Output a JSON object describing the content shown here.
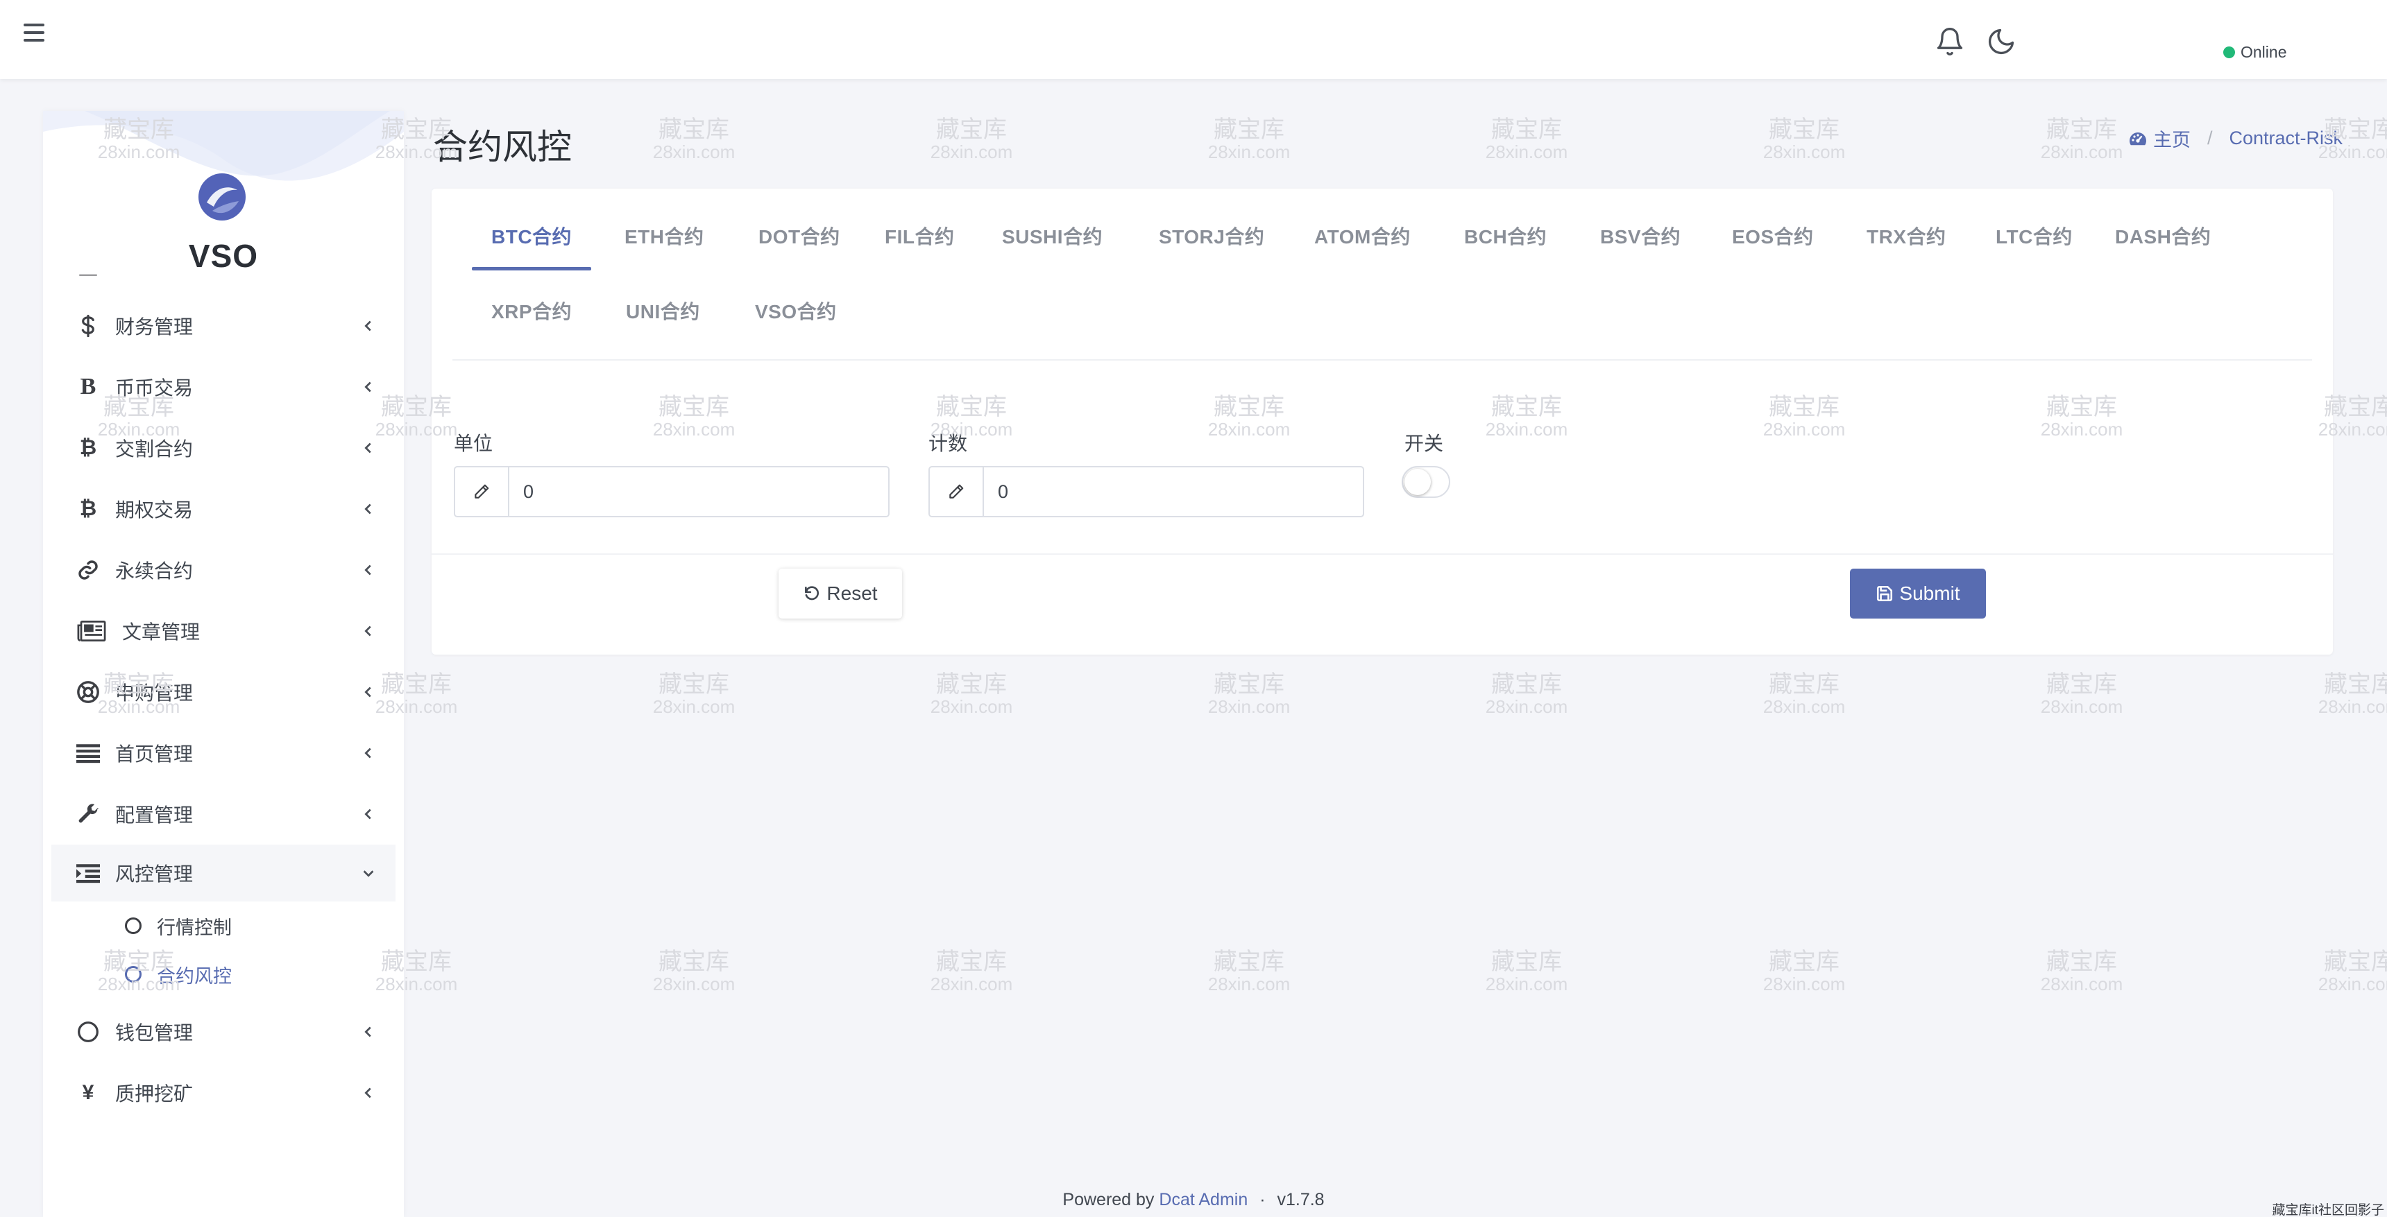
{
  "navbar": {
    "status_label": "Online",
    "colors": {
      "status_dot": "#21b978"
    }
  },
  "sidebar": {
    "brand": "VSO",
    "items": [
      {
        "label": "财务管理",
        "icon": "dollar-icon"
      },
      {
        "label": "币币交易",
        "icon": "letter-b-icon"
      },
      {
        "label": "交割合约",
        "icon": "bitcoin-icon"
      },
      {
        "label": "期权交易",
        "icon": "bitcoin-icon"
      },
      {
        "label": "永续合约",
        "icon": "link-icon"
      },
      {
        "label": "文章管理",
        "icon": "newspaper-icon"
      },
      {
        "label": "申购管理",
        "icon": "lifebuoy-icon"
      },
      {
        "label": "首页管理",
        "icon": "list-icon"
      },
      {
        "label": "配置管理",
        "icon": "wrench-icon"
      },
      {
        "label": "风控管理",
        "icon": "indent-list-icon",
        "expanded": true
      },
      {
        "label": "钱包管理",
        "icon": "circle-icon"
      },
      {
        "label": "质押挖矿",
        "icon": "yen-icon"
      }
    ],
    "sub_items": [
      {
        "label": "行情控制",
        "active": false
      },
      {
        "label": "合约风控",
        "active": true
      }
    ]
  },
  "page": {
    "title": "合约风控",
    "breadcrumb": {
      "home": "主页",
      "current": "Contract-Risk"
    }
  },
  "tabs": [
    "BTC合约",
    "ETH合约",
    "DOT合约",
    "FIL合约",
    "SUSHI合约",
    "STORJ合约",
    "ATOM合约",
    "BCH合约",
    "BSV合约",
    "EOS合约",
    "TRX合约",
    "LTC合约",
    "DASH合约",
    "XRP合约",
    "UNI合约",
    "VSO合约"
  ],
  "active_tab": "BTC合约",
  "form": {
    "unit": {
      "label": "单位",
      "value": "0"
    },
    "count": {
      "label": "计数",
      "value": "0"
    },
    "switch": {
      "label": "开关",
      "on": false
    },
    "reset_label": "Reset",
    "submit_label": "Submit"
  },
  "footer": {
    "powered_by": "Powered by",
    "link": "Dcat Admin",
    "separator": "·",
    "version": "v1.7.8"
  },
  "watermark": {
    "line1": "藏宝库",
    "line2": "28xin.com"
  },
  "corner_mark": "藏宝库it社区回影子",
  "colors": {
    "accent": "#586cb1",
    "background": "#f4f5f9"
  }
}
